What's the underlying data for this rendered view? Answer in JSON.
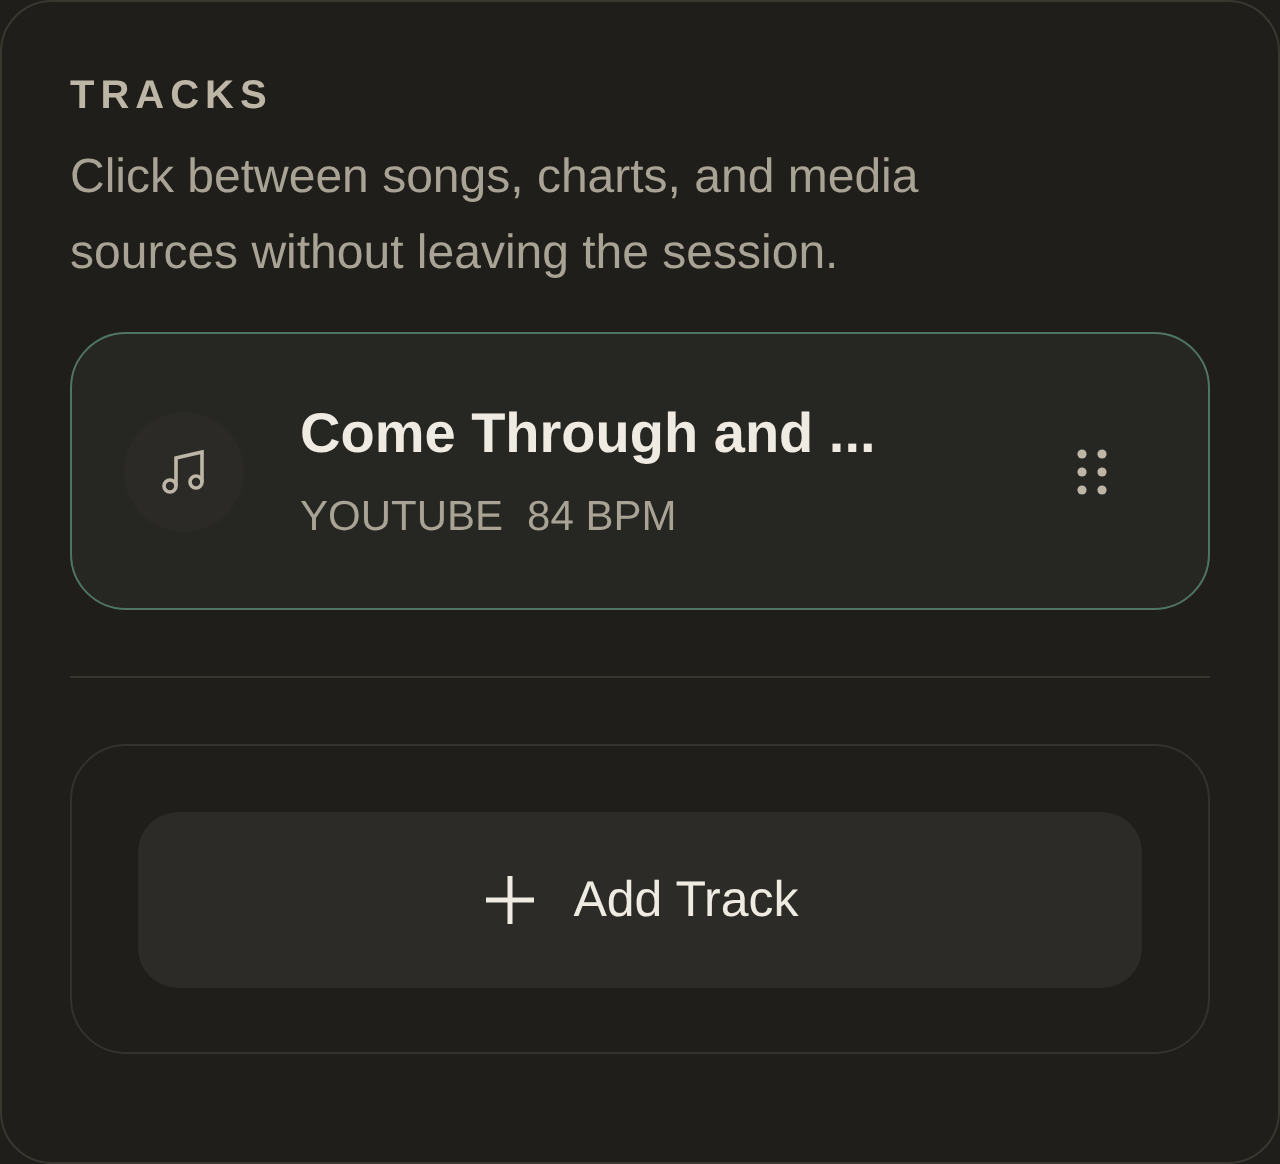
{
  "section": {
    "heading": "TRACKS",
    "description": "Click between songs, charts, and media sources without leaving the session."
  },
  "tracks": [
    {
      "title": "Come Through and ...",
      "source": "YOUTUBE",
      "tempo": "84 BPM",
      "selected": true
    }
  ],
  "add_button": {
    "label": "Add Track"
  }
}
